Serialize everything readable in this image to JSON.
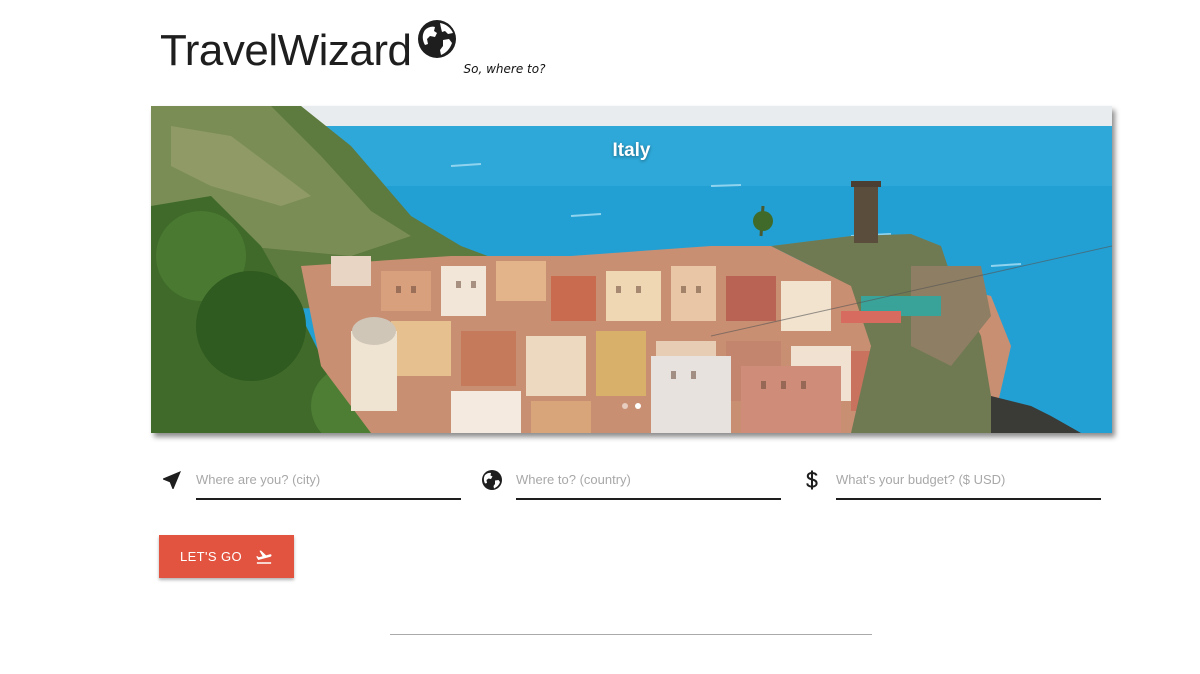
{
  "header": {
    "title": "TravelWizard",
    "tagline": "So, where to?",
    "logo_icon": "globe-icon"
  },
  "carousel": {
    "slide_caption": "Italy",
    "slide_count": 2,
    "active_slide": 2
  },
  "form": {
    "origin": {
      "icon": "navigation-arrow-icon",
      "placeholder": "Where are you? (city)",
      "value": ""
    },
    "destination": {
      "icon": "globe-icon",
      "placeholder": "Where to? (country)",
      "value": ""
    },
    "budget": {
      "icon": "dollar-icon",
      "placeholder": "What's your budget? ($ USD)",
      "value": ""
    },
    "submit_label": "LET'S GO",
    "submit_icon": "flight-takeoff-icon"
  },
  "colors": {
    "accent": "#e25440",
    "sea": "#2aa5d6",
    "text": "#1e1e1e"
  }
}
